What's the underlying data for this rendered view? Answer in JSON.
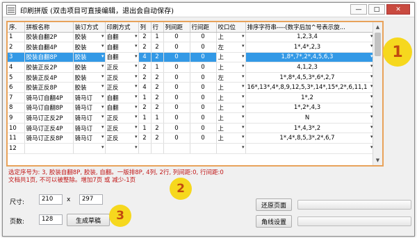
{
  "window": {
    "title": "印刷拼版 (双击项目可直接编辑，退出会自动保存)",
    "buttons": {
      "minimize": "—",
      "maximize": "□",
      "close": "✕"
    }
  },
  "grid": {
    "columns": [
      "序.",
      "拼板名称",
      "装订方式",
      "印刷方式",
      "列",
      "行",
      "列间距",
      "行间距",
      "咬口位",
      "排序字符串----(数字后加^号表示旋..."
    ],
    "rows": [
      [
        "1",
        "胶装自翻2P",
        "胶装",
        "自翻",
        "2",
        "1",
        "0",
        "0",
        "上",
        "1,2,3,4"
      ],
      [
        "2",
        "胶装自翻4P",
        "胶装",
        "自翻",
        "2",
        "2",
        "0",
        "0",
        "左",
        "1*,4*,2,3"
      ],
      [
        "3",
        "胶装自翻8P",
        "胶装",
        "自翻",
        "4",
        "2",
        "0",
        "0",
        "上",
        "1,8*,7*,2*,4,5,6,3"
      ],
      [
        "4",
        "胶装正反2P",
        "胶装",
        "正反",
        "2",
        "1",
        "0",
        "0",
        "上",
        "4,1,2,3"
      ],
      [
        "5",
        "胶装正反4P",
        "胶装",
        "正反",
        "2",
        "2",
        "0",
        "0",
        "左",
        "1*,8*,4,5,3*,6*,2,7"
      ],
      [
        "6",
        "胶装正反8P",
        "胶装",
        "正反",
        "4",
        "2",
        "0",
        "0",
        "上",
        "16*,13*,4*,8,9,12,5,3*,14*,15*,2*,6,11,1"
      ],
      [
        "7",
        "骑马订自翻4P",
        "骑马订",
        "自翻",
        "1",
        "2",
        "0",
        "0",
        "上",
        "1*,2"
      ],
      [
        "8",
        "骑马订自翻8P",
        "骑马订",
        "自翻",
        "2",
        "2",
        "0",
        "0",
        "上",
        "1*,2*,4,3"
      ],
      [
        "9",
        "骑马订正反2P",
        "骑马订",
        "正反",
        "1",
        "1",
        "0",
        "0",
        "上",
        "N"
      ],
      [
        "10",
        "骑马订正反4P",
        "骑马订",
        "正反",
        "1",
        "2",
        "0",
        "0",
        "上",
        "1*,4,3*,2"
      ],
      [
        "11",
        "骑马订正反8P",
        "骑马订",
        "正反",
        "2",
        "2",
        "0",
        "0",
        "上",
        "1*,4*,8,5,3*,2*,6,7"
      ],
      [
        "12",
        "",
        "",
        "",
        "",
        "",
        "",
        "",
        "",
        ""
      ]
    ],
    "selected_row": "3"
  },
  "status": {
    "line1": "选定序号为: 3, 胶装自翻8P, 胶装, 自翻。一版排8P, 4列, 2行, 列间距:0, 行间距:0",
    "line2": "文档共1页, 不可以被整除。增加7页 或 减少-1页"
  },
  "form": {
    "size_label": "尺寸:",
    "width": "210",
    "x_sep": "x",
    "height": "297",
    "pages_label": "页数:",
    "pages": "128",
    "generate_button": "生成草稿",
    "restore_button": "还原页面",
    "crop_button": "角线设置"
  },
  "badges": [
    "1",
    "2",
    "3"
  ],
  "colors": {
    "highlight": "#3399e6",
    "status_text": "#c11616",
    "badge": "#f6d81e",
    "grid_border": "#e8a25a"
  }
}
